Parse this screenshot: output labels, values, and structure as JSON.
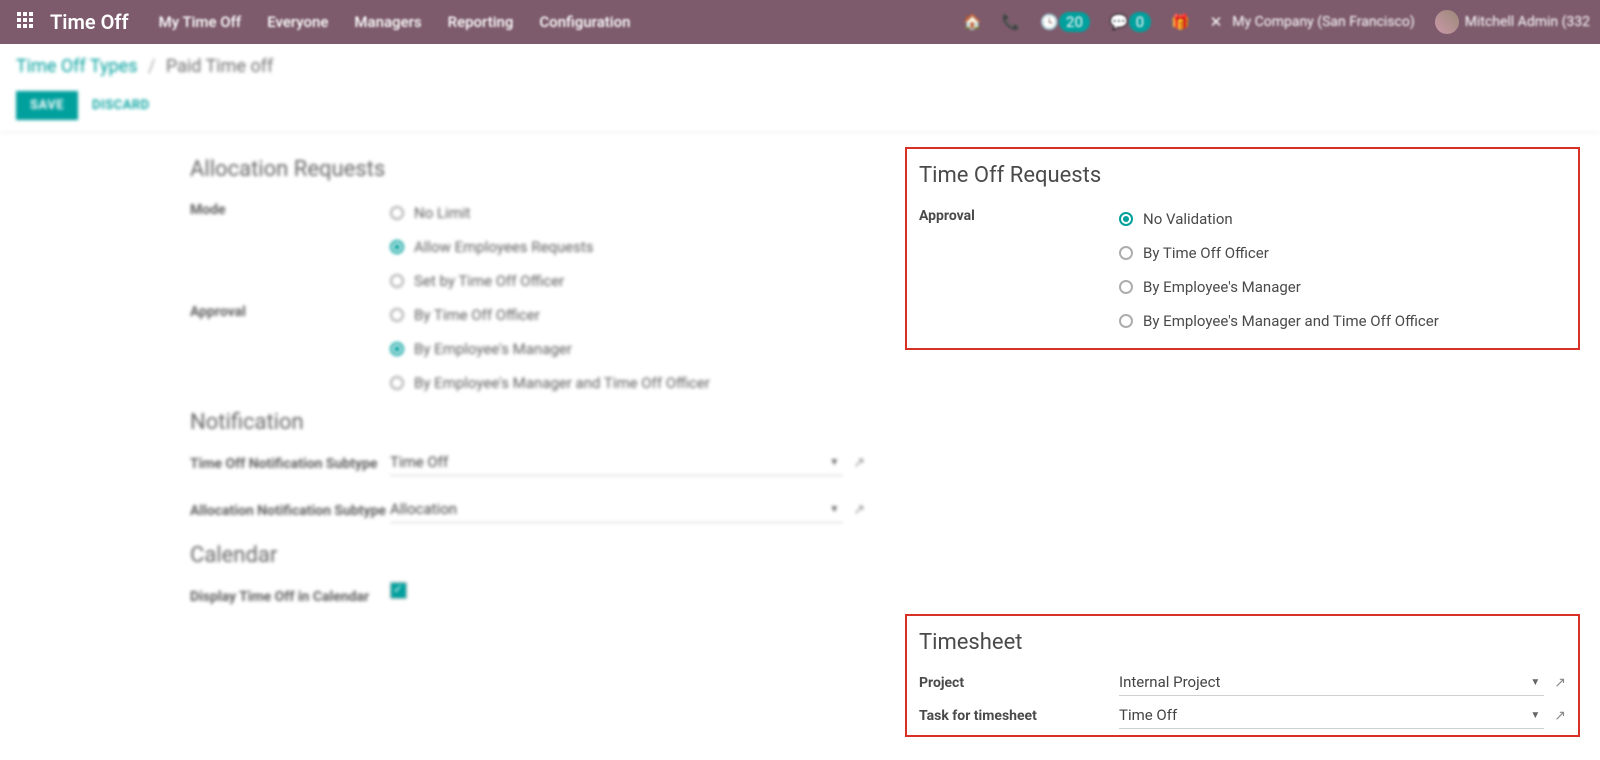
{
  "topnav": {
    "brand": "Time Off",
    "menu": [
      "My Time Off",
      "Everyone",
      "Managers",
      "Reporting",
      "Configuration"
    ],
    "tray_badge1": "20",
    "tray_badge2": "0",
    "company": "My Company (San Francisco)",
    "user": "Mitchell Admin (332"
  },
  "breadcrumb": {
    "parent": "Time Off Types",
    "current": "Paid Time off"
  },
  "buttons": {
    "save": "SAVE",
    "discard": "DISCARD"
  },
  "left": {
    "allocation": {
      "title": "Allocation Requests",
      "mode_label": "Mode",
      "mode_opts": [
        "No Limit",
        "Allow Employees Requests",
        "Set by Time Off Officer"
      ],
      "mode_sel": 1,
      "approval_label": "Approval",
      "approval_opts": [
        "By Time Off Officer",
        "By Employee's Manager",
        "By Employee's Manager and Time Off Officer"
      ],
      "approval_sel": 1
    },
    "notification": {
      "title": "Notification",
      "f1_label": "Time Off Notification Subtype",
      "f1_value": "Time Off",
      "f2_label": "Allocation Notification Subtype",
      "f2_value": "Allocation"
    },
    "calendar": {
      "title": "Calendar",
      "f1_label": "Display Time Off in Calendar"
    }
  },
  "right": {
    "timeoff": {
      "title": "Time Off Requests",
      "approval_label": "Approval",
      "opts": [
        "No Validation",
        "By Time Off Officer",
        "By Employee's Manager",
        "By Employee's Manager and Time Off Officer"
      ],
      "sel": 0
    },
    "timesheet": {
      "title": "Timesheet",
      "project_label": "Project",
      "project_value": "Internal Project",
      "task_label": "Task for timesheet",
      "task_value": "Time Off"
    }
  }
}
